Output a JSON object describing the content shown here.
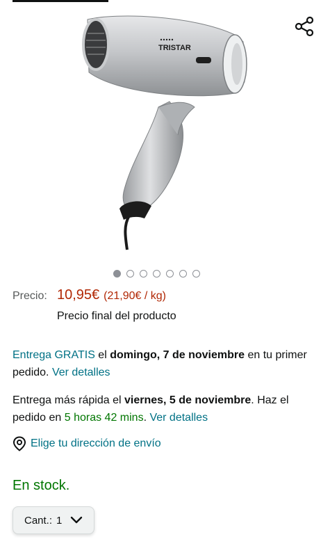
{
  "product": {
    "brand_on_image": "TRISTAR",
    "image_count": 7,
    "active_image": 1
  },
  "price": {
    "label": "Precio:",
    "amount": "10,95€",
    "unit_price": "(21,90€ / kg)",
    "final_note": "Precio final del producto"
  },
  "delivery": {
    "free_prefix": "Entrega GRATIS",
    "free_mid": " el ",
    "free_date": "domingo, 7 de noviembre",
    "free_suffix": " en tu primer pedido. ",
    "free_link": "Ver detalles",
    "fast_prefix": "Entrega más rápida el ",
    "fast_date": "viernes, 5 de noviembre",
    "fast_mid": ". Haz el pedido en ",
    "fast_countdown": "5 horas 42 mins",
    "fast_dot": ". ",
    "fast_link": "Ver detalles"
  },
  "address": {
    "link": "Elige tu dirección de envío",
    "icon": "location-pin-icon"
  },
  "stock": {
    "status": "En stock."
  },
  "quantity": {
    "label": "Cant.:",
    "value": "1"
  },
  "colors": {
    "price": "#b12704",
    "link": "#007185",
    "stock": "#007600"
  }
}
